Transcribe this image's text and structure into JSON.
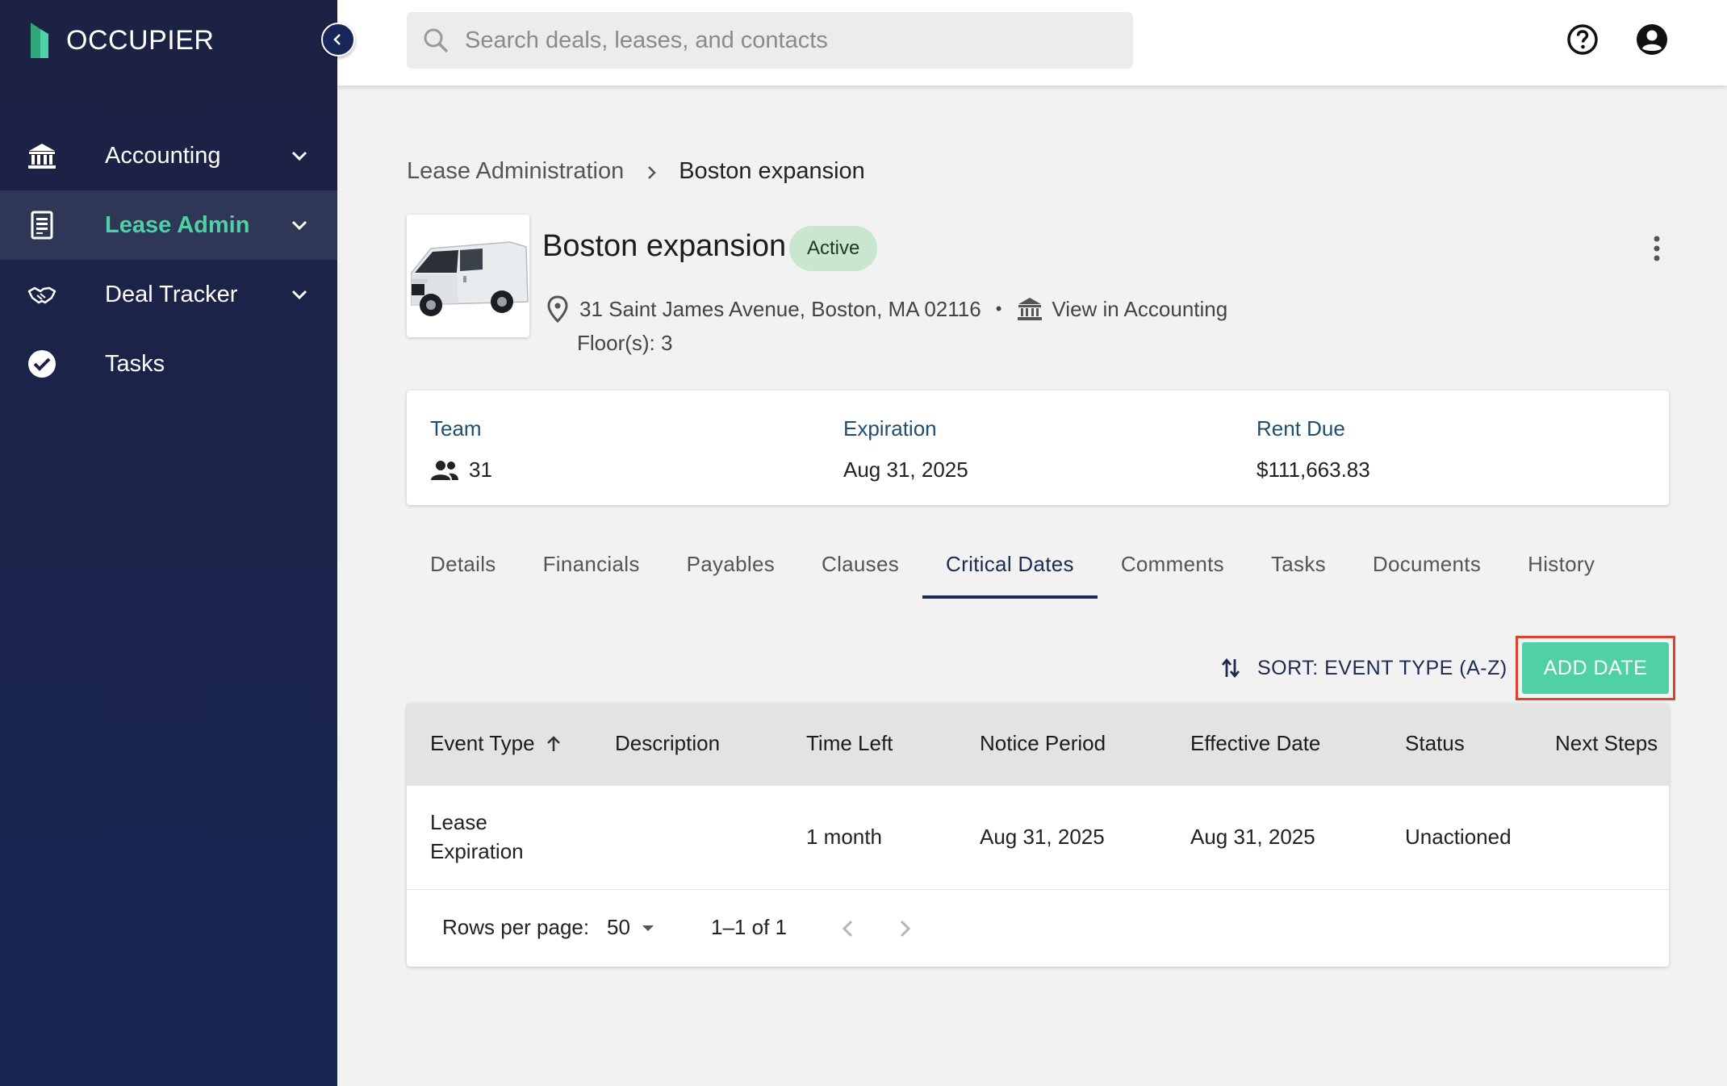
{
  "brand": {
    "name": "OCCUPIER",
    "accent": "#4fd1a5",
    "sidebar_bg": "#1c2243"
  },
  "sidebar": {
    "items": [
      {
        "label": "Accounting",
        "icon": "bank-icon",
        "expandable": true,
        "active": false
      },
      {
        "label": "Lease Admin",
        "icon": "document-icon",
        "expandable": true,
        "active": true
      },
      {
        "label": "Deal Tracker",
        "icon": "handshake-icon",
        "expandable": true,
        "active": false
      },
      {
        "label": "Tasks",
        "icon": "check-circle-icon",
        "expandable": false,
        "active": false
      }
    ]
  },
  "search": {
    "placeholder": "Search deals, leases, and contacts",
    "value": ""
  },
  "breadcrumb": {
    "parent": "Lease Administration",
    "current": "Boston expansion"
  },
  "property": {
    "title": "Boston expansion",
    "status": "Active",
    "address": "31 Saint James Avenue, Boston, MA 02116",
    "accounting_link": "View in Accounting",
    "floors": "Floor(s): 3"
  },
  "summary": {
    "team_label": "Team",
    "team_value": "31",
    "expiration_label": "Expiration",
    "expiration_value": "Aug 31, 2025",
    "rent_label": "Rent Due",
    "rent_value": "$111,663.83"
  },
  "tabs": [
    "Details",
    "Financials",
    "Payables",
    "Clauses",
    "Critical Dates",
    "Comments",
    "Tasks",
    "Documents",
    "History"
  ],
  "active_tab": "Critical Dates",
  "toolbar": {
    "sort_label": "SORT: EVENT TYPE (A-Z)",
    "add_label": "ADD DATE"
  },
  "table": {
    "columns": [
      "Event Type",
      "Description",
      "Time Left",
      "Notice Period",
      "Effective Date",
      "Status",
      "Next Steps"
    ],
    "rows": [
      {
        "event_type_line1": "Lease",
        "event_type_line2": "Expiration",
        "description": "",
        "time_left": "1 month",
        "notice_period": "Aug 31, 2025",
        "effective_date": "Aug 31, 2025",
        "status": "Unactioned",
        "next_steps": ""
      }
    ],
    "pagination": {
      "rows_label": "Rows per page:",
      "rows_value": "50",
      "range": "1–1 of 1"
    }
  }
}
